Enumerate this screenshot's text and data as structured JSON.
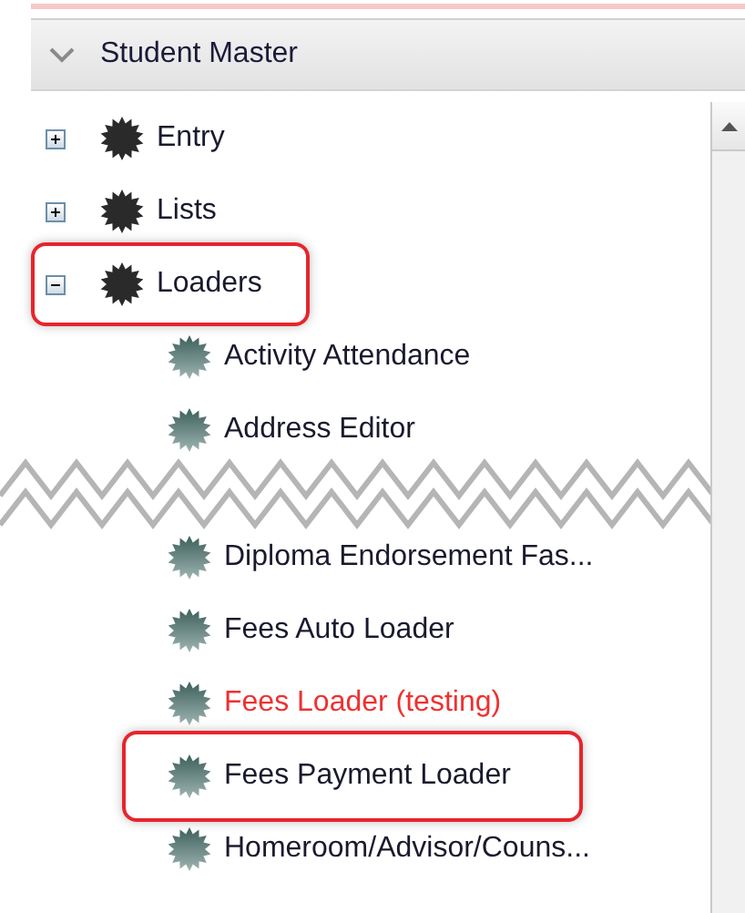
{
  "panel": {
    "title": "Student Master",
    "expanded": true
  },
  "tree": [
    {
      "label": "Entry",
      "expanded": false,
      "highlighted": false
    },
    {
      "label": "Lists",
      "expanded": false,
      "highlighted": false
    },
    {
      "label": "Loaders",
      "expanded": true,
      "highlighted": true,
      "children": [
        {
          "kind": "item",
          "label": "Activity Attendance",
          "color": "#1a1a2e",
          "highlighted": false
        },
        {
          "kind": "item",
          "label": "Address Editor",
          "color": "#1a1a2e",
          "highlighted": false
        },
        {
          "kind": "break"
        },
        {
          "kind": "item",
          "label": "Diploma Endorsement Fas...",
          "color": "#1a1a2e",
          "highlighted": false
        },
        {
          "kind": "item",
          "label": "Fees Auto Loader",
          "color": "#1a1a2e",
          "highlighted": false
        },
        {
          "kind": "item",
          "label": "Fees Loader (testing)",
          "color": "#f03030",
          "highlighted": false
        },
        {
          "kind": "item",
          "label": "Fees Payment Loader",
          "color": "#1a1a2e",
          "highlighted": true
        },
        {
          "kind": "item",
          "label": "Homeroom/Advisor/Couns...",
          "color": "#1a1a2e",
          "highlighted": false
        }
      ]
    }
  ]
}
